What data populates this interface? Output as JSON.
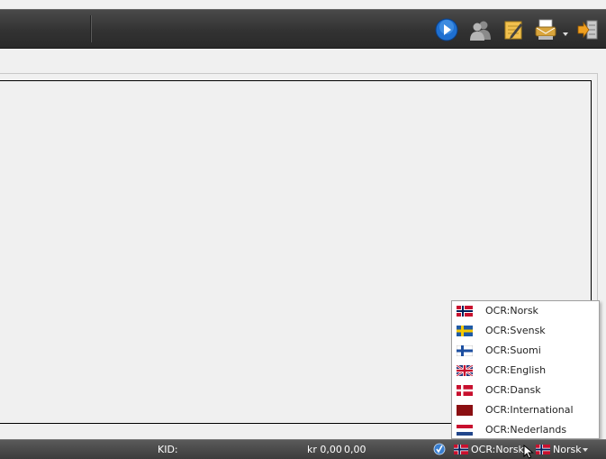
{
  "toolbar": {
    "icons": [
      "play-forward-icon",
      "users-icon",
      "notepad-icon",
      "mail-print-icon",
      "exit-icon"
    ]
  },
  "statusbar": {
    "kid_label": "KID:",
    "amount": "kr 0,00",
    "amount2": "0,00",
    "ocr_selected": "OCR:Norsk",
    "language_selected": "Norsk"
  },
  "ocr_menu": {
    "items": [
      {
        "label": "OCR:Norsk",
        "flag": "norway"
      },
      {
        "label": "OCR:Svensk",
        "flag": "sweden"
      },
      {
        "label": "OCR:Suomi",
        "flag": "finland"
      },
      {
        "label": "OCR:English",
        "flag": "uk"
      },
      {
        "label": "OCR:Dansk",
        "flag": "denmark"
      },
      {
        "label": "OCR:International",
        "flag": "international"
      },
      {
        "label": "OCR:Nederlands",
        "flag": "netherlands"
      }
    ]
  },
  "colors": {
    "toolbar_bg": "#323232",
    "statusbar_bg": "#4a4a4a",
    "menu_bg": "#ffffff"
  }
}
